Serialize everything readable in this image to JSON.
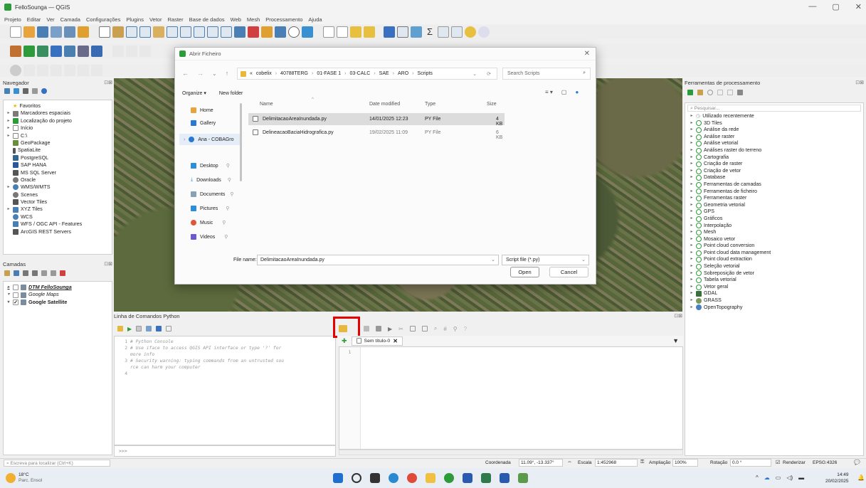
{
  "window": {
    "title": "FelloSounga — QGIS",
    "controls": [
      "—",
      "▢",
      "✕"
    ]
  },
  "menu": [
    "Projeto",
    "Editar",
    "Ver",
    "Camada",
    "Configurações",
    "Plugins",
    "Vetor",
    "Raster",
    "Base de dados",
    "Web",
    "Mesh",
    "Processamento",
    "Ajuda"
  ],
  "navigator": {
    "title": "Navegador",
    "items": [
      {
        "label": "Favoritos",
        "icon": "star-icon",
        "color": "#e6b800",
        "tri": ""
      },
      {
        "label": "Marcadores espaciais",
        "icon": "bookmark-icon",
        "color": "#7a7a7a",
        "tri": "▸"
      },
      {
        "label": "Localização do projeto",
        "icon": "folder-icon",
        "color": "#2e9b3a",
        "tri": "▸"
      },
      {
        "label": "Início",
        "icon": "home-icon",
        "color": "#888",
        "tri": "▸"
      },
      {
        "label": "C:\\",
        "icon": "drive-icon",
        "color": "#888",
        "tri": "▸"
      },
      {
        "label": "GeoPackage",
        "icon": "geopackage-icon",
        "color": "#6b8e3e",
        "tri": ""
      },
      {
        "label": "SpatiaLite",
        "icon": "spatialite-icon",
        "color": "#555",
        "tri": ""
      },
      {
        "label": "PostgreSQL",
        "icon": "postgresql-icon",
        "color": "#336791",
        "tri": ""
      },
      {
        "label": "SAP HANA",
        "icon": "sap-hana-icon",
        "color": "#2b5797",
        "tri": ""
      },
      {
        "label": "MS SQL Server",
        "icon": "mssql-icon",
        "color": "#555",
        "tri": ""
      },
      {
        "label": "Oracle",
        "icon": "oracle-icon",
        "color": "#777",
        "tri": ""
      },
      {
        "label": "WMS/WMTS",
        "icon": "wms-icon",
        "color": "#4a7fb5",
        "tri": "▸"
      },
      {
        "label": "Scenes",
        "icon": "scenes-icon",
        "color": "#777",
        "tri": ""
      },
      {
        "label": "Vector Tiles",
        "icon": "vector-tiles-icon",
        "color": "#555",
        "tri": ""
      },
      {
        "label": "XYZ Tiles",
        "icon": "xyz-tiles-icon",
        "color": "#4a7fb5",
        "tri": "▸"
      },
      {
        "label": "WCS",
        "icon": "wcs-icon",
        "color": "#4a7fb5",
        "tri": ""
      },
      {
        "label": "WFS / OGC API - Features",
        "icon": "wfs-icon",
        "color": "#4a7fb5",
        "tri": ""
      },
      {
        "label": "ArcGIS REST Servers",
        "icon": "arcgis-icon",
        "color": "#555",
        "tri": ""
      }
    ]
  },
  "layers": {
    "title": "Camadas",
    "items": [
      {
        "label": "DTM FelloSounga",
        "checked": false,
        "tri": "▸"
      },
      {
        "label": "Google Maps",
        "checked": false,
        "tri": "▾"
      },
      {
        "label": "Google Satellite",
        "checked": true,
        "tri": "▾"
      }
    ]
  },
  "dialog": {
    "title": "Abrir Ficheiro",
    "path": [
      "«",
      "cobelix",
      "40788TERG",
      "01-FASE 1",
      "03-CALC",
      "SAE",
      "ARO",
      "Scripts"
    ],
    "search_placeholder": "Search Scripts",
    "organize": "Organize ▾",
    "new_folder": "New folder",
    "sidebar": [
      {
        "label": "Home",
        "icon": "home-icon",
        "color": "#e8a33d"
      },
      {
        "label": "Gallery",
        "icon": "gallery-icon",
        "color": "#2b78d4"
      },
      {
        "label": "Ana - COBAGro",
        "icon": "cloud-icon",
        "color": "#2b78d4"
      },
      {
        "label": "Desktop",
        "icon": "desktop-icon",
        "color": "#2b8fd8"
      },
      {
        "label": "Downloads",
        "icon": "download-icon",
        "color": "#2b8fd8"
      },
      {
        "label": "Documents",
        "icon": "document-icon",
        "color": "#8aa1b5"
      },
      {
        "label": "Pictures",
        "icon": "pictures-icon",
        "color": "#2b8fd8"
      },
      {
        "label": "Music",
        "icon": "music-icon",
        "color": "#e0553b"
      },
      {
        "label": "Videos",
        "icon": "videos-icon",
        "color": "#6a5acd"
      }
    ],
    "columns": [
      "Name",
      "Date modified",
      "Type",
      "Size"
    ],
    "files": [
      {
        "name": "DelimitacaoAreaInundada.py",
        "date": "14/01/2025 12:23",
        "type": "PY File",
        "size": "4 KB",
        "selected": true
      },
      {
        "name": "DelineacaoBaciaHidrografica.py",
        "date": "19/02/2025 11:09",
        "type": "PY File",
        "size": "6 KB",
        "selected": false
      }
    ],
    "file_name_label": "File name:",
    "file_name_value": "DelimitacaoAreaInundada.py",
    "filter": "Script file (*.py)",
    "open": "Open",
    "cancel": "Cancel"
  },
  "python_console": {
    "title": "Linha de Comandos Python",
    "line_numbers": [
      "1",
      "2",
      "3",
      "4"
    ],
    "lines": [
      "# Python Console",
      "# Use iface to access QGIS API interface or type '?' for",
      "more info",
      "# Security warning: typing commands from an untrusted sou",
      "rce can harm your computer"
    ],
    "prompt": ">>>",
    "editor_tab": "Sem título-0",
    "editor_line": "1"
  },
  "processing": {
    "title": "Ferramentas de processamento",
    "search_placeholder": "Pesquisar...",
    "items": [
      "Utilizado recentemente",
      "3D Tiles",
      "Análise da rede",
      "Análise raster",
      "Análise vetorial",
      "Análises raster do terreno",
      "Cartografia",
      "Criação de raster",
      "Criação de vetor",
      "Database",
      "Ferramentas de camadas",
      "Ferramentas de ficheiro",
      "Ferramentas raster",
      "Geometria vetorial",
      "GPS",
      "Gráficos",
      "Interpolação",
      "Mesh",
      "Mosaico vetor",
      "Point cloud conversion",
      "Point cloud data management",
      "Point cloud extraction",
      "Seleção vetorial",
      "Sobreposição de vetor",
      "Tabela vetorial",
      "Vetor geral",
      "GDAL",
      "GRASS",
      "OpenTopography"
    ]
  },
  "status": {
    "locate_placeholder": "Escreva para localizar (Ctrl+K)",
    "coord_label": "Coordenada",
    "coord_value": "11.09°, -13.337°",
    "scale_label": "Escala",
    "scale_value": "1:452968",
    "zoom_label": "Ampliação",
    "zoom_value": "100%",
    "rotation_label": "Rotação",
    "rotation_value": "0.0 °",
    "render_label": "Renderizar",
    "crs": "EPSG:4326"
  },
  "taskbar": {
    "weather_temp": "18°C",
    "weather_desc": "Parc. Ensol",
    "time": "14:49",
    "date": "20/02/2025"
  }
}
